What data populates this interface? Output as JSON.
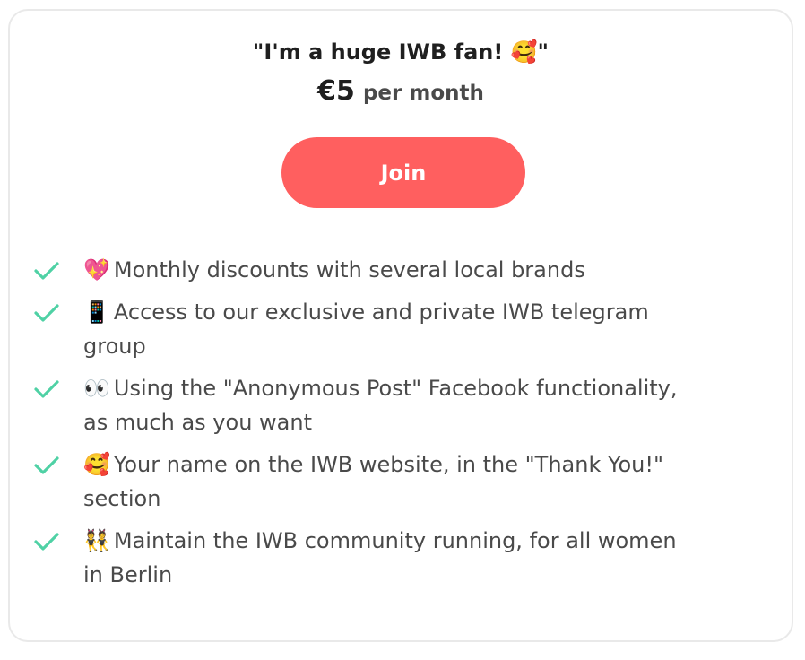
{
  "tier": {
    "title": "\"I'm a huge IWB fan! 🥰\"",
    "price": "€5",
    "period": "per month"
  },
  "join_button": {
    "label": "Join"
  },
  "colors": {
    "accent": "#ff5f5f",
    "check": "#4fd1a5",
    "text_dark": "#1f1f1f",
    "text_body": "#4a4a4a",
    "border": "#e9e9e9"
  },
  "benefits": [
    {
      "emoji": "💖",
      "text": "Monthly discounts with several local brands",
      "icon": "sparkling-heart-icon"
    },
    {
      "emoji": "📱",
      "text": "Access to our exclusive and private IWB telegram group",
      "icon": "mobile-phone-icon"
    },
    {
      "emoji": "👀",
      "text": "Using the \"Anonymous Post\" Facebook functionality, as much as you want",
      "icon": "eyes-icon"
    },
    {
      "emoji": "🥰",
      "text": "Your name on the IWB website, in the \"Thank You!\" section",
      "icon": "smiling-face-hearts-icon"
    },
    {
      "emoji": "👯",
      "text": "Maintain the IWB community running, for all women in Berlin",
      "icon": "dancers-icon"
    }
  ]
}
